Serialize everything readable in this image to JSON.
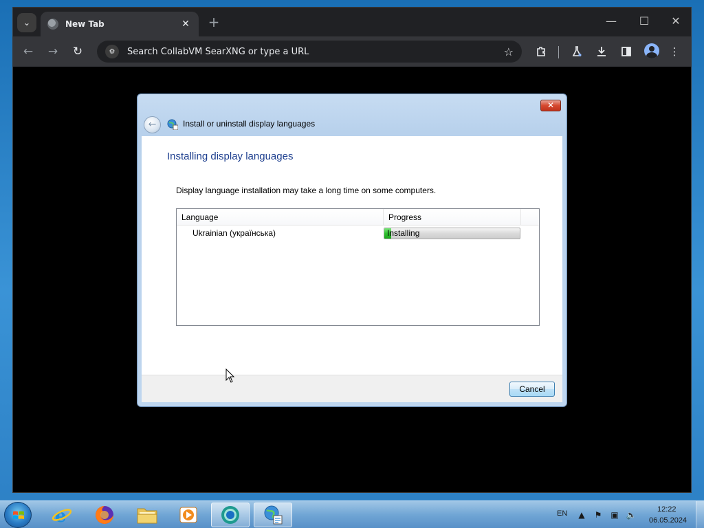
{
  "browser": {
    "tab_search_icon": "chevron-down-icon",
    "tab": {
      "title": "New Tab",
      "favicon": "globe-icon",
      "close_label": "✕"
    },
    "new_tab_label": "+",
    "window_controls": {
      "minimize": "—",
      "maximize": "☐",
      "close": "✕"
    },
    "nav": {
      "back": "←",
      "forward": "→",
      "reload": "↻"
    },
    "omnibox": {
      "placeholder": "Search CollabVM SearXNG or type a URL",
      "value": ""
    },
    "toolbar_icons": [
      "bookmark-star-icon",
      "extensions-icon",
      "labs-flask-icon",
      "download-icon",
      "side-panel-icon",
      "profile-icon",
      "menu-kebab-icon"
    ]
  },
  "dialog": {
    "header": "Install or uninstall display languages",
    "title": "Installing display languages",
    "description": "Display language installation may take a long time on some computers.",
    "columns": {
      "language": "Language",
      "progress": "Progress"
    },
    "rows": [
      {
        "language": "Ukrainian (українська)",
        "status": "Installing",
        "progress_percent": 5
      }
    ],
    "cancel_label": "Cancel",
    "close_label": "✕",
    "back_label": "←"
  },
  "taskbar": {
    "apps": [
      "internet-explorer-icon",
      "firefox-icon",
      "file-explorer-icon",
      "media-player-icon",
      "chrome-icon",
      "language-settings-icon"
    ],
    "active_app": "language-settings-icon",
    "tray": {
      "language": "EN",
      "time": "12:22",
      "date": "06.05.2024"
    }
  },
  "colors": {
    "dialog_title": "#1e3f8f",
    "progress_green": "#2fc12f",
    "browser_dark": "#202124"
  }
}
